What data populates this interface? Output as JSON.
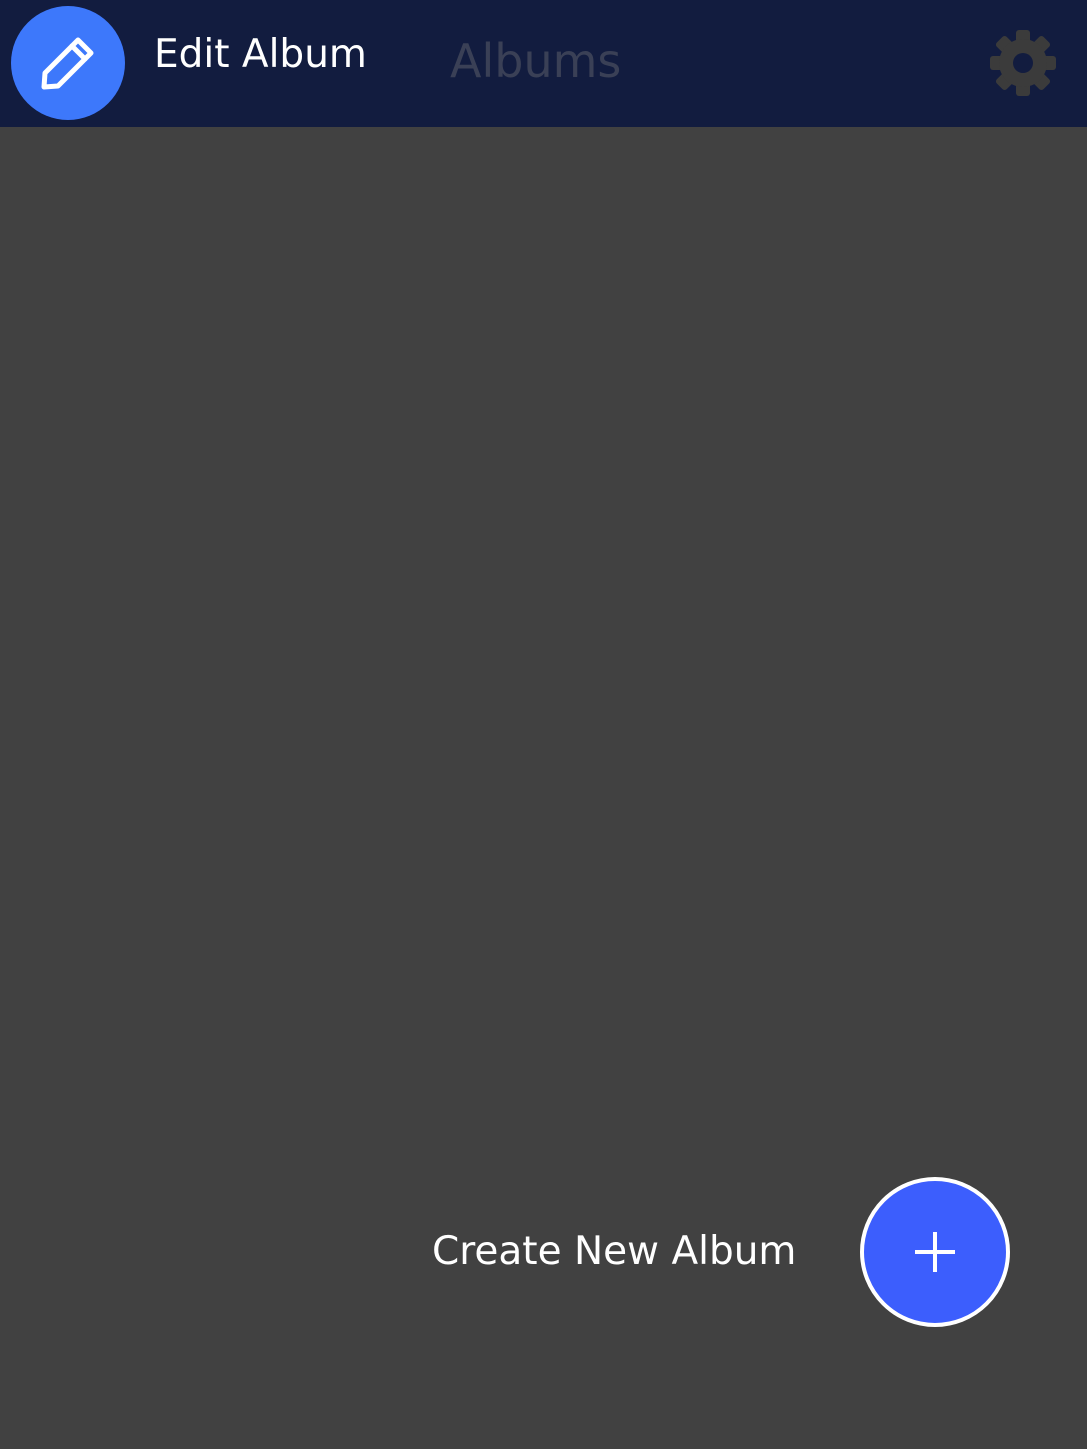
{
  "header": {
    "edit_label": "Edit Album",
    "title": "Albums",
    "edit_icon": "pencil-icon",
    "settings_icon": "gear-icon"
  },
  "fab": {
    "create_label": "Create New Album",
    "icon": "plus-icon"
  },
  "colors": {
    "topbar": "#121c3f",
    "background": "#414141",
    "edit_button": "#3d78fb",
    "create_button": "#3c5efd",
    "title_text": "#3a4056",
    "settings_icon": "#3b3b3b"
  }
}
